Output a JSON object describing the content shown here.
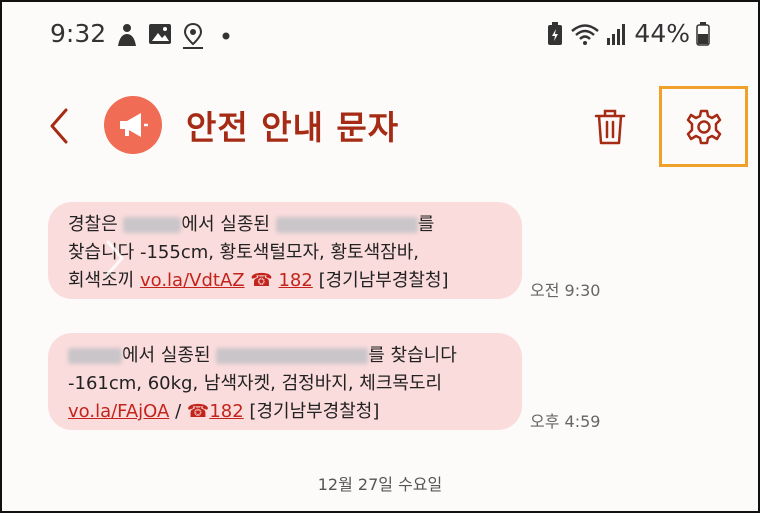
{
  "status_bar": {
    "time": "9:32",
    "battery": "44%"
  },
  "header": {
    "title": "안전 안내 문자"
  },
  "messages": [
    {
      "line1a": "경찰은",
      "line1b": "에서 실종된",
      "line1c": "를",
      "line2": "찾습니다 -155cm, 황토색털모자, 황토색잠바,",
      "line3a": "회색조끼",
      "link": "vo.la/VdtAZ",
      "tel_icon": "☎",
      "tel": "182",
      "source": "[경기남부경찰청]",
      "time": "오전 9:30"
    },
    {
      "line1b": "에서 실종된",
      "line1c": "를 찾습니다",
      "line2": "-161cm, 60kg, 남색자켓, 검정바지, 체크목도리",
      "link": "vo.la/FAjOA",
      "sep": "/",
      "tel_icon": "☎",
      "tel": "182",
      "source": "[경기남부경찰청]",
      "time": "오후 4:59"
    }
  ],
  "date_separator": "12월 27일 수요일",
  "colors": {
    "accent": "#a52b14",
    "avatar": "#f06c55",
    "bubble": "#fbdcdc",
    "highlight": "#f0a12a"
  }
}
